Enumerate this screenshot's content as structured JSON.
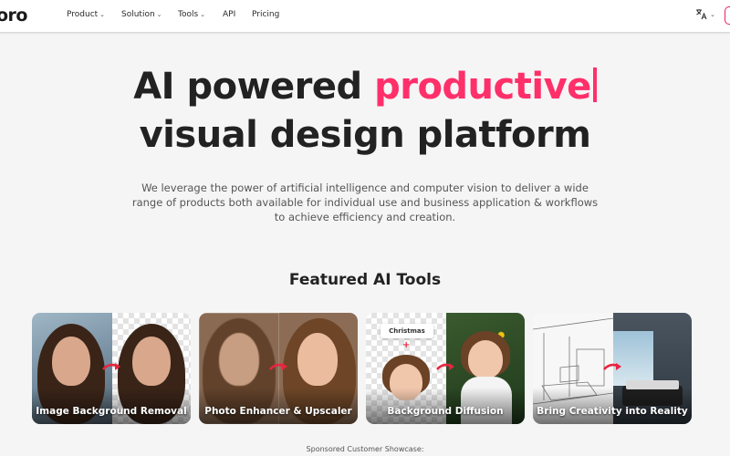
{
  "nav": {
    "logo": "oro",
    "items": [
      {
        "label": "Product",
        "has_dropdown": true
      },
      {
        "label": "Solution",
        "has_dropdown": true
      },
      {
        "label": "Tools",
        "has_dropdown": true
      },
      {
        "label": "API",
        "has_dropdown": false
      },
      {
        "label": "Pricing",
        "has_dropdown": false
      }
    ],
    "language_icon": "translate-icon"
  },
  "hero": {
    "line1_prefix": "AI powered ",
    "line1_accent": "productive",
    "line2": "visual design platform",
    "subtitle": "We leverage the power of artificial intelligence and computer vision to deliver a wide range of products both available for individual use and business application & workflows to achieve efficiency and creation."
  },
  "featured": {
    "title": "Featured AI Tools",
    "tools": [
      {
        "label": "Image Background Removal"
      },
      {
        "label": "Photo Enhancer & Upscaler"
      },
      {
        "label": "Background Diffusion",
        "tag": "Christmas",
        "tag_symbol": "+"
      },
      {
        "label": "Bring Creativity into Reality"
      }
    ]
  },
  "footer_note": "Sponsored Customer Showcase:",
  "colors": {
    "accent": "#ff2f6a",
    "arrow": "#e8243f"
  }
}
